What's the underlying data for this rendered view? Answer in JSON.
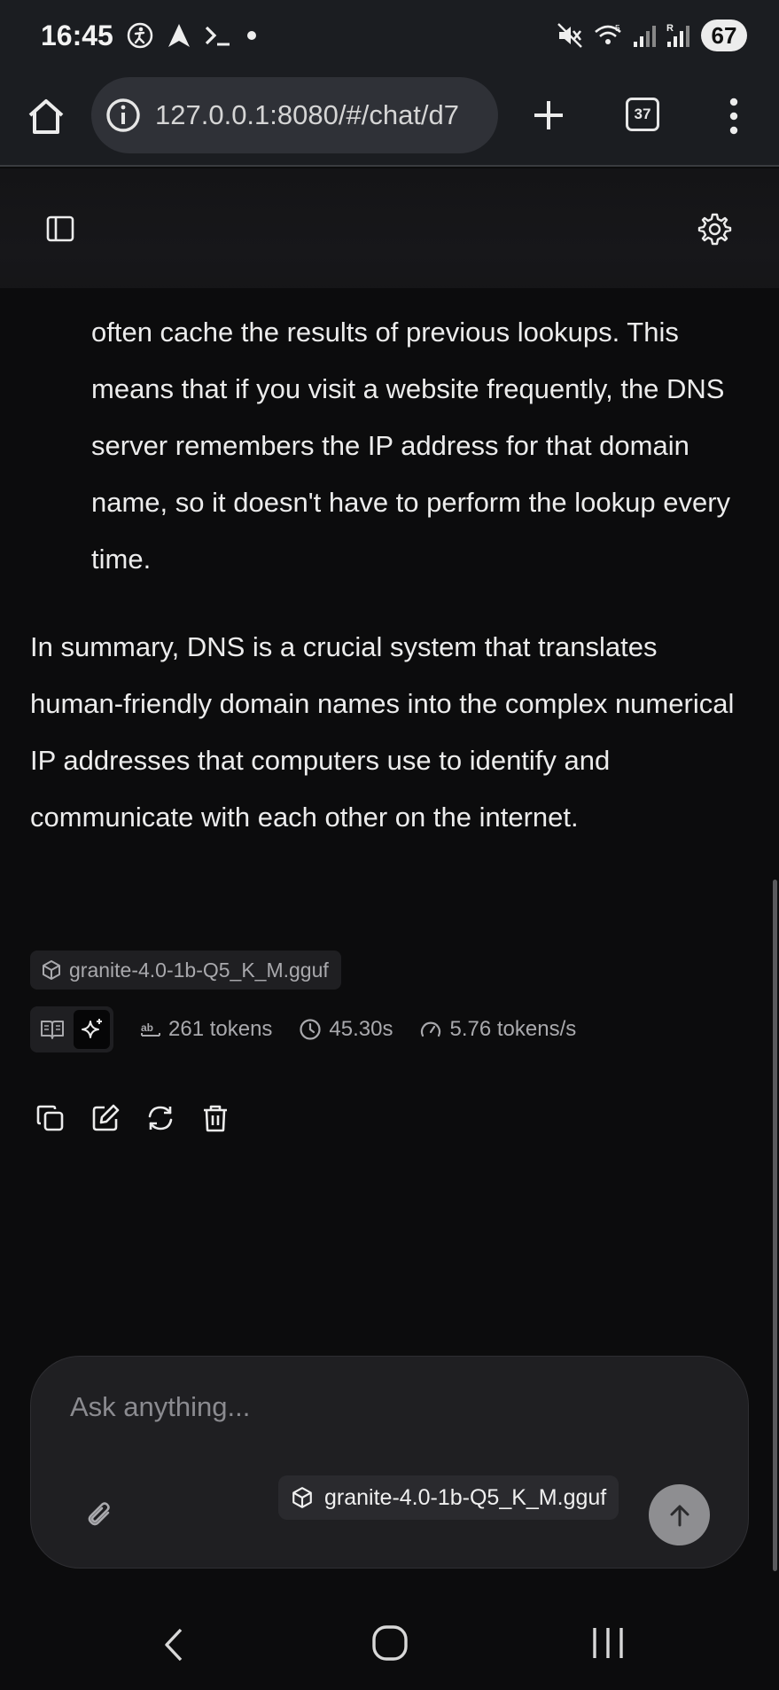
{
  "status_bar": {
    "time": "16:45",
    "battery": "67",
    "left_icons": [
      "accessibility-icon",
      "navigation-icon",
      "terminal-icon",
      "dot-icon"
    ],
    "right_icons": [
      "mute-icon",
      "wifi-icon",
      "signal-icon",
      "signal-r-icon"
    ]
  },
  "browser": {
    "url": "127.0.0.1:8080/#/chat/d7",
    "tab_count": "37"
  },
  "chat": {
    "bullet_text": "often cache the results of previous lookups. This means that if you visit a website frequently, the DNS server remembers the IP address for that domain name, so it doesn't have to perform the lookup every time.",
    "summary_text": "In summary, DNS is a crucial system that translates human-friendly domain names into the complex numerical IP addresses that computers use to identify and communicate with each other on the internet.",
    "model": "granite-4.0-1b-Q5_K_M.gguf",
    "stats": {
      "tokens": "261 tokens",
      "time": "45.30s",
      "speed": "5.76 tokens/s"
    }
  },
  "composer": {
    "placeholder": "Ask anything...",
    "model": "granite-4.0-1b-Q5_K_M.gguf"
  }
}
